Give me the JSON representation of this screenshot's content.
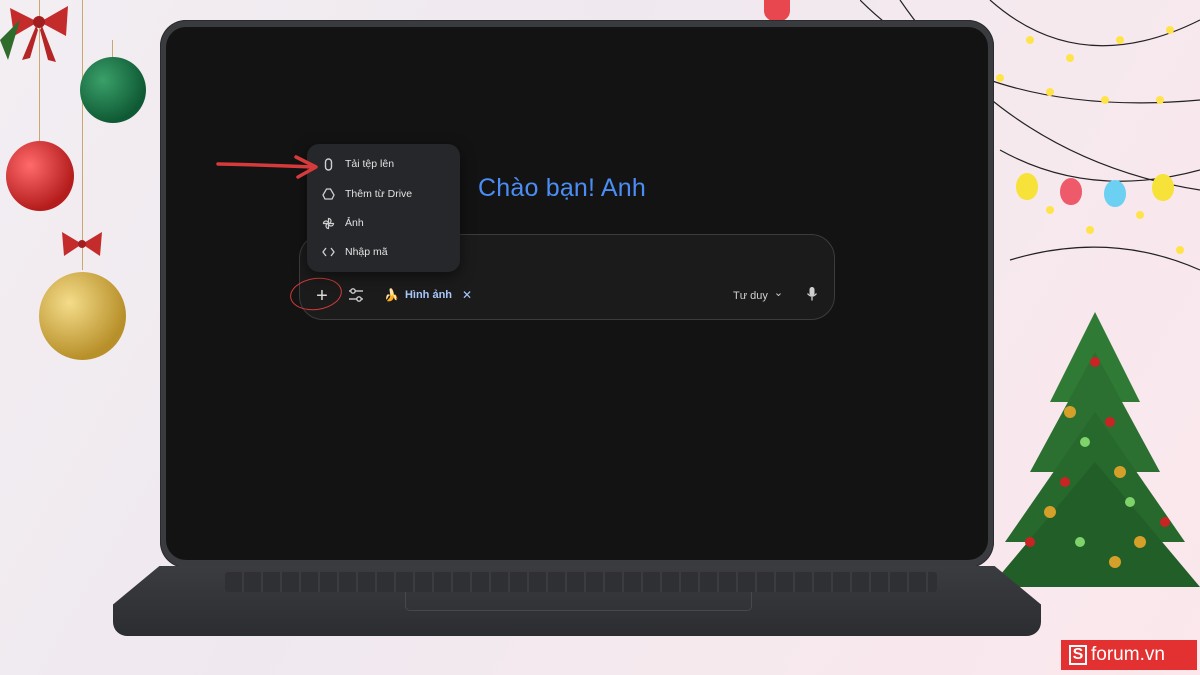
{
  "gemini": {
    "greeting": "Chào bạn! Anh",
    "menu": [
      {
        "label": "Tải tệp lên",
        "icon": "paperclip-icon"
      },
      {
        "label": "Thêm từ Drive",
        "icon": "drive-icon"
      },
      {
        "label": "Ảnh",
        "icon": "photos-icon"
      },
      {
        "label": "Nhập mã",
        "icon": "code-icon"
      }
    ],
    "toolbar": {
      "plus_label": "+",
      "chip_label": "Hình ảnh",
      "chip_close": "✕",
      "mode_label": "Tư duy",
      "mode_chevron": "⌄"
    }
  },
  "watermark": {
    "brand": "forum.vn",
    "brand_letter": "S"
  },
  "colors": {
    "accent_blue": "#4b8df5",
    "chip_blue": "#a8c7fa",
    "annotation_red": "#d63a3a",
    "brand_red": "#e33030"
  }
}
